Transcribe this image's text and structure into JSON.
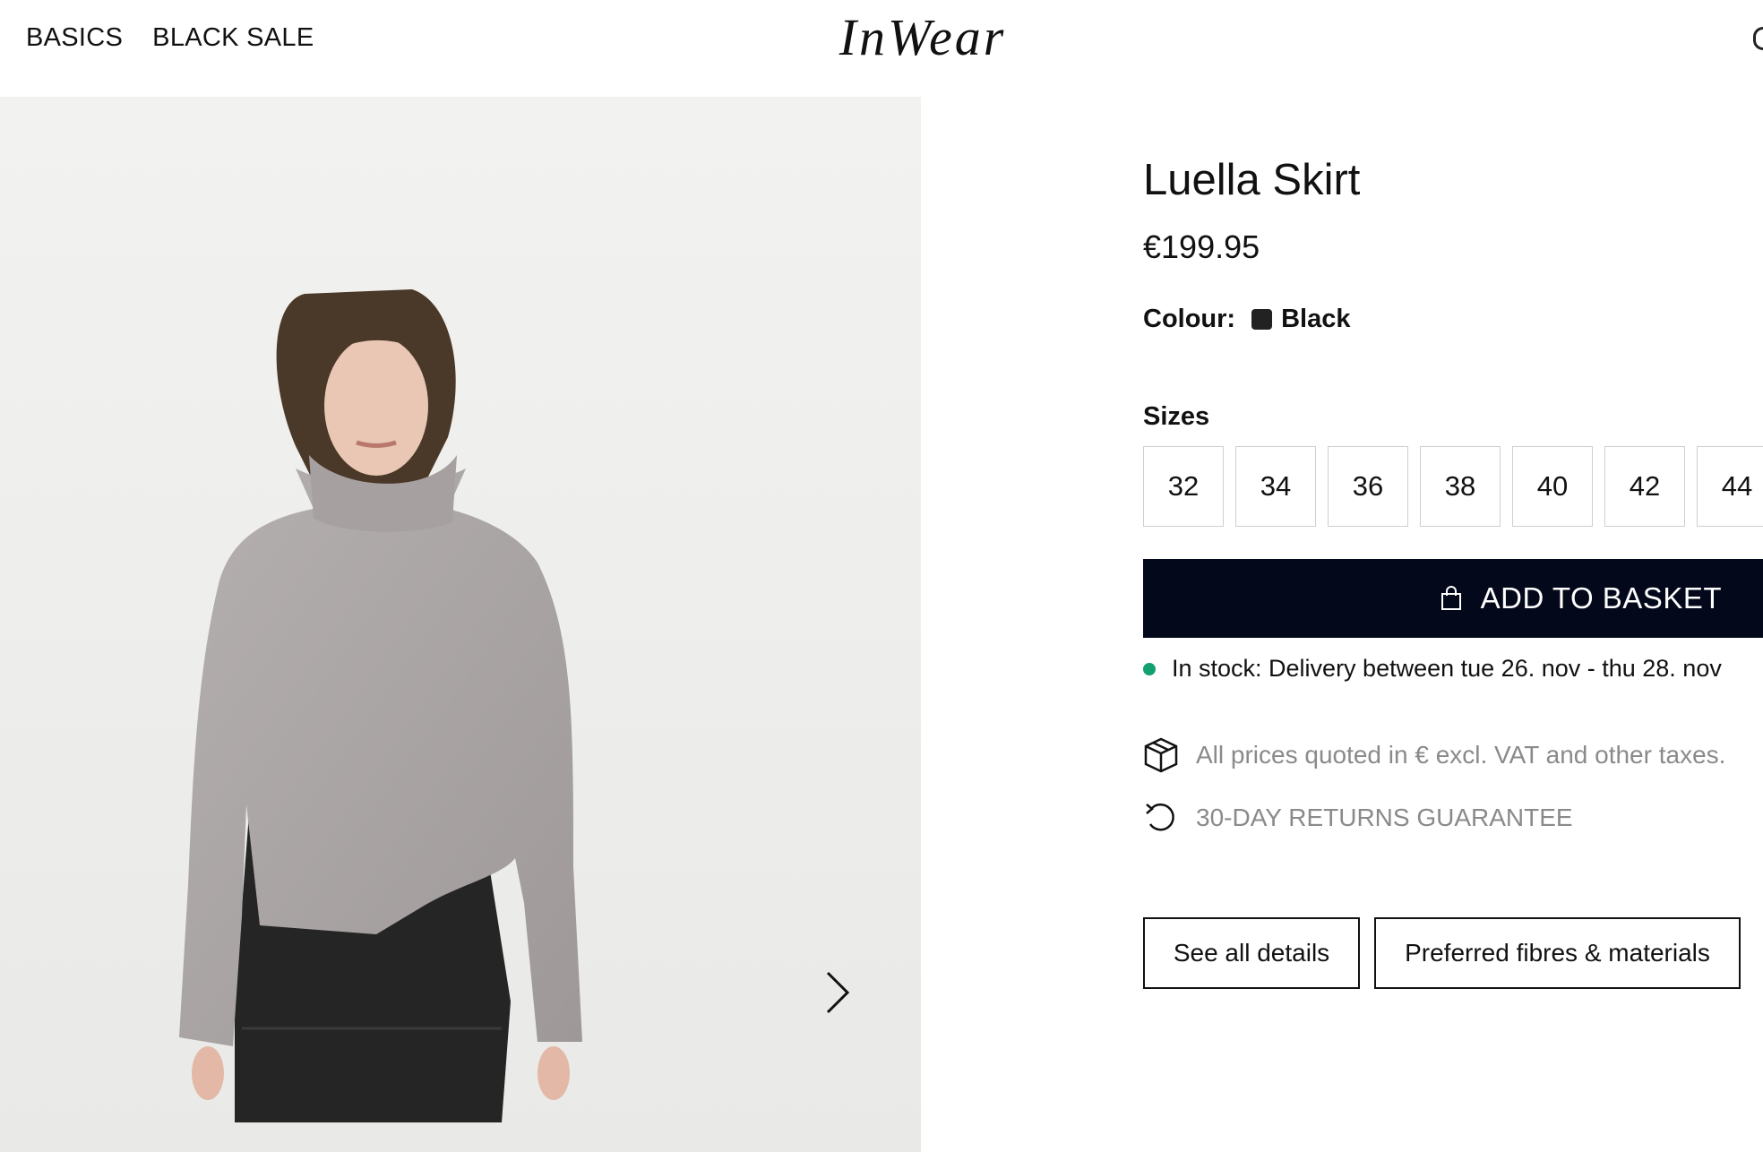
{
  "header": {
    "nav": [
      "BASICS",
      "BLACK SALE"
    ],
    "logo": "InWear"
  },
  "gallery": {
    "next_icon": "chevron-right-icon"
  },
  "product": {
    "title": "Luella Skirt",
    "price": "€199.95",
    "colour_label": "Colour:",
    "colour_value": "Black",
    "colour_hex": "#222222",
    "sizes_label": "Sizes",
    "sizes": [
      "32",
      "34",
      "36",
      "38",
      "40",
      "42",
      "44"
    ],
    "add_to_basket": "ADD TO BASKET",
    "basket_icon": "shopping-bag-icon",
    "stock_text": "In stock: Delivery between tue 26. nov - thu 28. nov",
    "stock_color": "#13a06f",
    "features": [
      {
        "icon": "package-box-icon",
        "text": "All prices quoted in € excl. VAT and other taxes."
      },
      {
        "icon": "return-arrow-icon",
        "text": "30-DAY RETURNS GUARANTEE"
      }
    ],
    "buttons": [
      "See all details",
      "Preferred fibres & materials"
    ]
  },
  "colors": {
    "accent_dark": "#03081a",
    "muted_text": "#8a8a8a"
  }
}
